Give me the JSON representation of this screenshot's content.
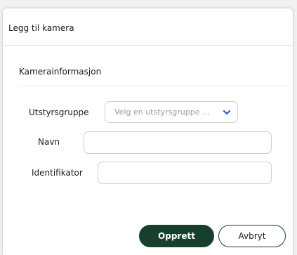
{
  "dialog": {
    "title": "Legg til kamera",
    "section_title": "Kamerainformasjon"
  },
  "form": {
    "equipment_group": {
      "label": "Utstyrsgruppe",
      "placeholder": "Velg en utstyrsgruppe ...",
      "chevron_icon": "chevron-down-icon"
    },
    "name": {
      "label": "Navn",
      "value": ""
    },
    "identifier": {
      "label": "Identifikator",
      "value": ""
    }
  },
  "actions": {
    "create_label": "Opprett",
    "cancel_label": "Avbryt"
  },
  "colors": {
    "primary": "#173f2e",
    "chevron": "#2c56c9",
    "border": "#cfcfcf",
    "placeholder": "#9a9a9a"
  }
}
